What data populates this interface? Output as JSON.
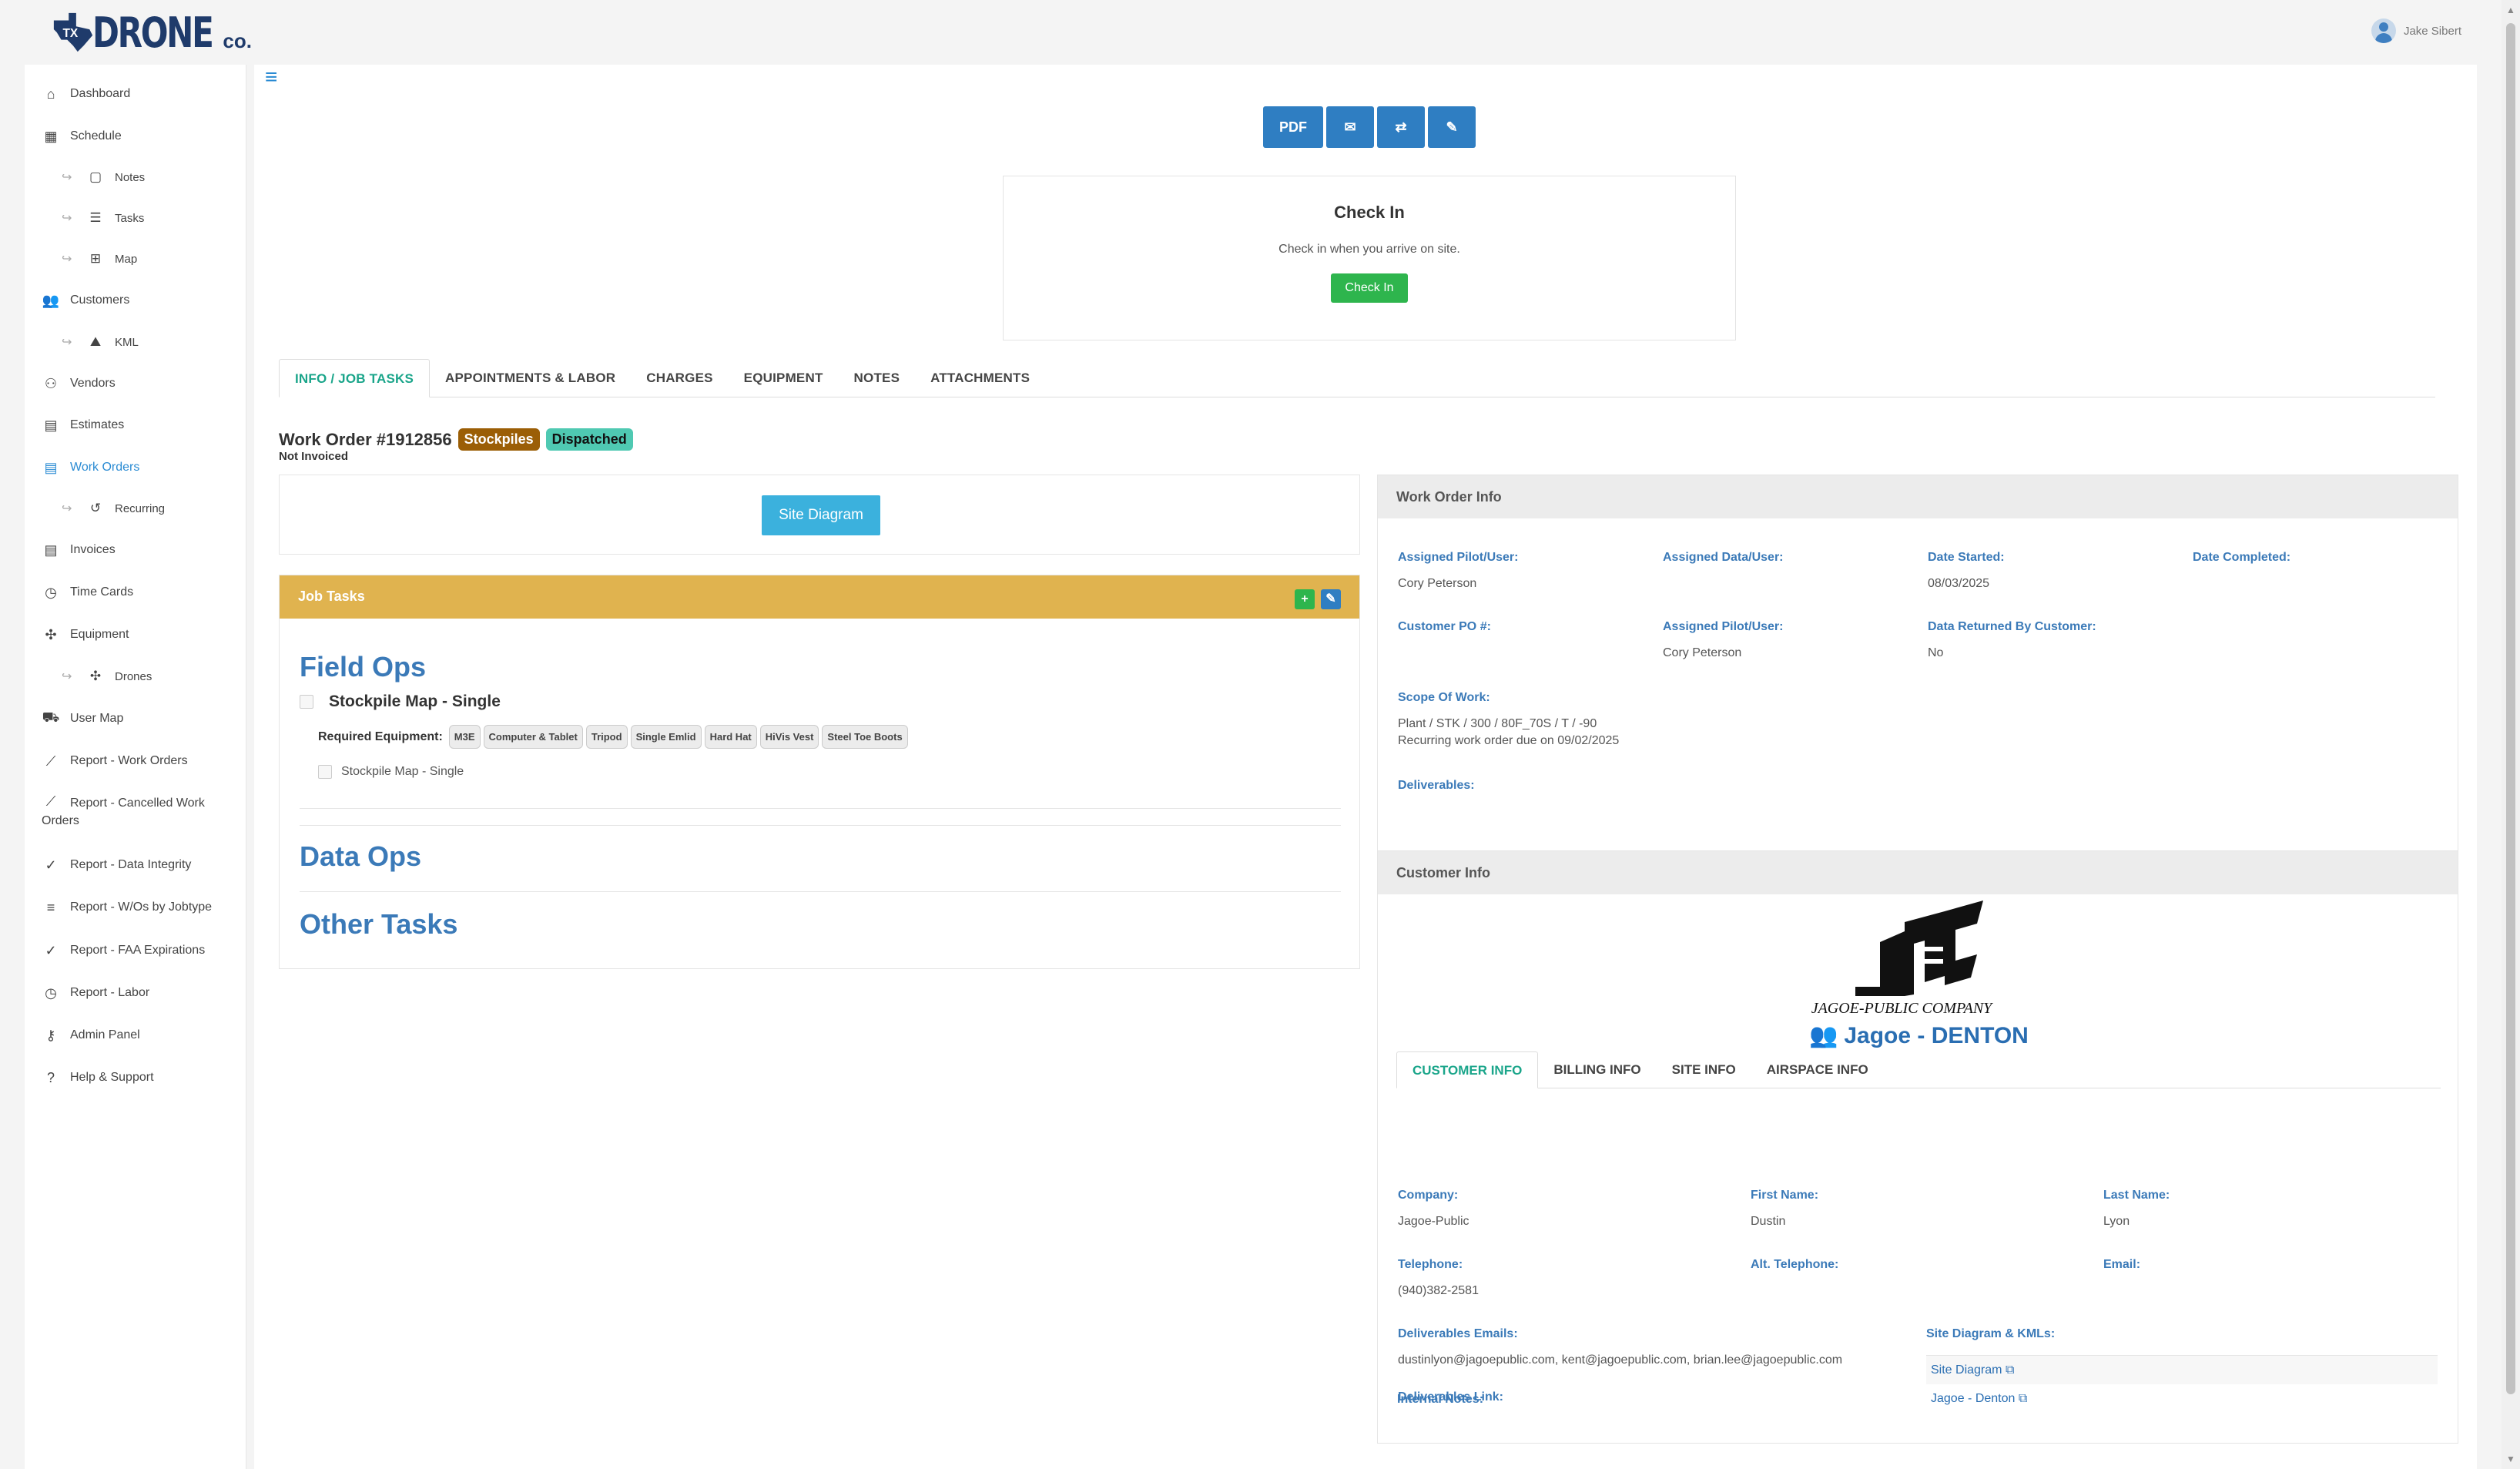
{
  "brand": {
    "logo_text": "DRONE",
    "logo_badge": "TX",
    "logo_suffix": "co."
  },
  "user": {
    "name": "Jake Sibert"
  },
  "sidebar": {
    "items": [
      {
        "label": "Dashboard",
        "icon": "home-icon"
      },
      {
        "label": "Schedule",
        "icon": "calendar-icon"
      },
      {
        "label": "Notes",
        "icon": "note-icon"
      },
      {
        "label": "Tasks",
        "icon": "tasks-icon"
      },
      {
        "label": "Map",
        "icon": "map-icon"
      },
      {
        "label": "Customers",
        "icon": "users-icon"
      },
      {
        "label": "KML",
        "icon": "kml-icon"
      },
      {
        "label": "Vendors",
        "icon": "vendors-icon"
      },
      {
        "label": "Estimates",
        "icon": "estimate-icon"
      },
      {
        "label": "Work Orders",
        "icon": "work-order-icon"
      },
      {
        "label": "Recurring",
        "icon": "history-icon"
      },
      {
        "label": "Invoices",
        "icon": "invoice-icon"
      },
      {
        "label": "Time Cards",
        "icon": "clock-icon"
      },
      {
        "label": "Equipment",
        "icon": "drone-icon"
      },
      {
        "label": "Drones",
        "icon": "drone-icon"
      },
      {
        "label": "User Map",
        "icon": "truck-icon"
      },
      {
        "label": "Report - Work Orders",
        "icon": "chart-icon"
      },
      {
        "label": "Report - Cancelled Work Orders",
        "icon": "chart-icon"
      },
      {
        "label": "Report - Data Integrity",
        "icon": "check-icon"
      },
      {
        "label": "Report - W/Os by Jobtype",
        "icon": "bar-chart-icon"
      },
      {
        "label": "Report - FAA Expirations",
        "icon": "check-icon"
      },
      {
        "label": "Report - Labor",
        "icon": "clock-icon"
      },
      {
        "label": "Admin Panel",
        "icon": "key-icon"
      },
      {
        "label": "Help & Support",
        "icon": "help-icon"
      }
    ]
  },
  "toolbar": {
    "pdf_label": "PDF",
    "email_icon": "envelope-icon",
    "repeat_icon": "repeat-icon",
    "edit_icon": "pencil-icon"
  },
  "checkin": {
    "title": "Check In",
    "description": "Check in when you arrive on site.",
    "button_label": "Check In"
  },
  "tabs": [
    "INFO / JOB TASKS",
    "APPOINTMENTS & LABOR",
    "CHARGES",
    "EQUIPMENT",
    "NOTES",
    "ATTACHMENTS"
  ],
  "work_order": {
    "title": "Work Order #1912856",
    "badge_type": "Stockpiles",
    "badge_status": "Dispatched",
    "invoice_status": "Not Invoiced",
    "site_diagram_label": "Site Diagram"
  },
  "job_tasks": {
    "title": "Job Tasks",
    "sections": [
      "Field Ops",
      "Data Ops",
      "Other Tasks"
    ],
    "task_title": "Stockpile Map - Single",
    "required_equipment_label": "Required Equipment:",
    "equipment": [
      "M3E",
      "Computer & Tablet",
      "Tripod",
      "Single Emlid",
      "Hard Hat",
      "HiVis Vest",
      "Steel Toe Boots"
    ],
    "subtask": "Stockpile Map - Single"
  },
  "wo_info": {
    "title": "Work Order Info",
    "assigned_pilot_label": "Assigned Pilot/User:",
    "assigned_pilot_value": "Cory Peterson",
    "assigned_data_label": "Assigned Data/User:",
    "date_started_label": "Date Started:",
    "date_started_value": "08/03/2025",
    "date_completed_label": "Date Completed:",
    "customer_po_label": "Customer PO #:",
    "assigned_pilot2_label": "Assigned Pilot/User:",
    "assigned_pilot2_value": "Cory Peterson",
    "data_returned_label": "Data Returned By Customer:",
    "data_returned_value": "No",
    "scope_label": "Scope Of Work:",
    "scope_line1": "Plant / STK / 300 / 80F_70S / T / -90",
    "scope_line2": "Recurring work order due on 09/02/2025",
    "deliverables_label": "Deliverables:"
  },
  "customer_info": {
    "title": "Customer Info",
    "logo_text": "JAGOE-PUBLIC COMPANY",
    "name": "Jagoe - DENTON",
    "tabs": [
      "CUSTOMER INFO",
      "BILLING INFO",
      "SITE INFO",
      "AIRSPACE INFO"
    ],
    "company_label": "Company:",
    "company_value": "Jagoe-Public",
    "first_name_label": "First Name:",
    "first_name_value": "Dustin",
    "last_name_label": "Last Name:",
    "last_name_value": "Lyon",
    "telephone_label": "Telephone:",
    "telephone_value": "(940)382-2581",
    "alt_telephone_label": "Alt. Telephone:",
    "email_label": "Email:",
    "deliverables_emails_label": "Deliverables Emails:",
    "deliverables_emails_value": "dustinlyon@jagoepublic.com, kent@jagoepublic.com, brian.lee@jagoepublic.com",
    "site_diagrams_label": "Site Diagram & KMLs:",
    "site_diagram_links": [
      "Site Diagram",
      "Jagoe - Denton"
    ],
    "deliverables_link_label": "Deliverables Link:",
    "internal_notes_label": "Internal Notes:"
  },
  "colors": {
    "accent": "#2f7ec2",
    "success": "#2eb54d",
    "warning": "#e0b34f",
    "teal": "#1aa58a"
  }
}
